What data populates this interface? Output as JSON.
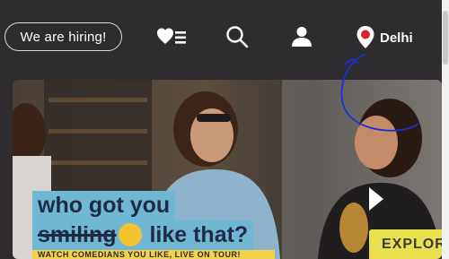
{
  "header": {
    "hiring_label": "We are hiring!",
    "location_city": "Delhi",
    "icons": {
      "wishlist": "heart-list-icon",
      "search": "search-icon",
      "account": "user-icon",
      "location": "location-pin-icon"
    }
  },
  "hero": {
    "caption_line1": "who got you",
    "caption_line2_strike": "smiling",
    "caption_line2_rest": " like that?",
    "caption_subline": "WATCH COMEDIANS YOU LIKE, LIVE ON TOUR!",
    "explore_label": "EXPLOR"
  },
  "colors": {
    "background": "#2e2c2f",
    "caption_bg": "#6fb7d3",
    "caption_text": "#1f2a44",
    "explore_bg": "#e9e04e",
    "pin_red": "#d8232a",
    "annotation_blue": "#1a2fd6"
  }
}
